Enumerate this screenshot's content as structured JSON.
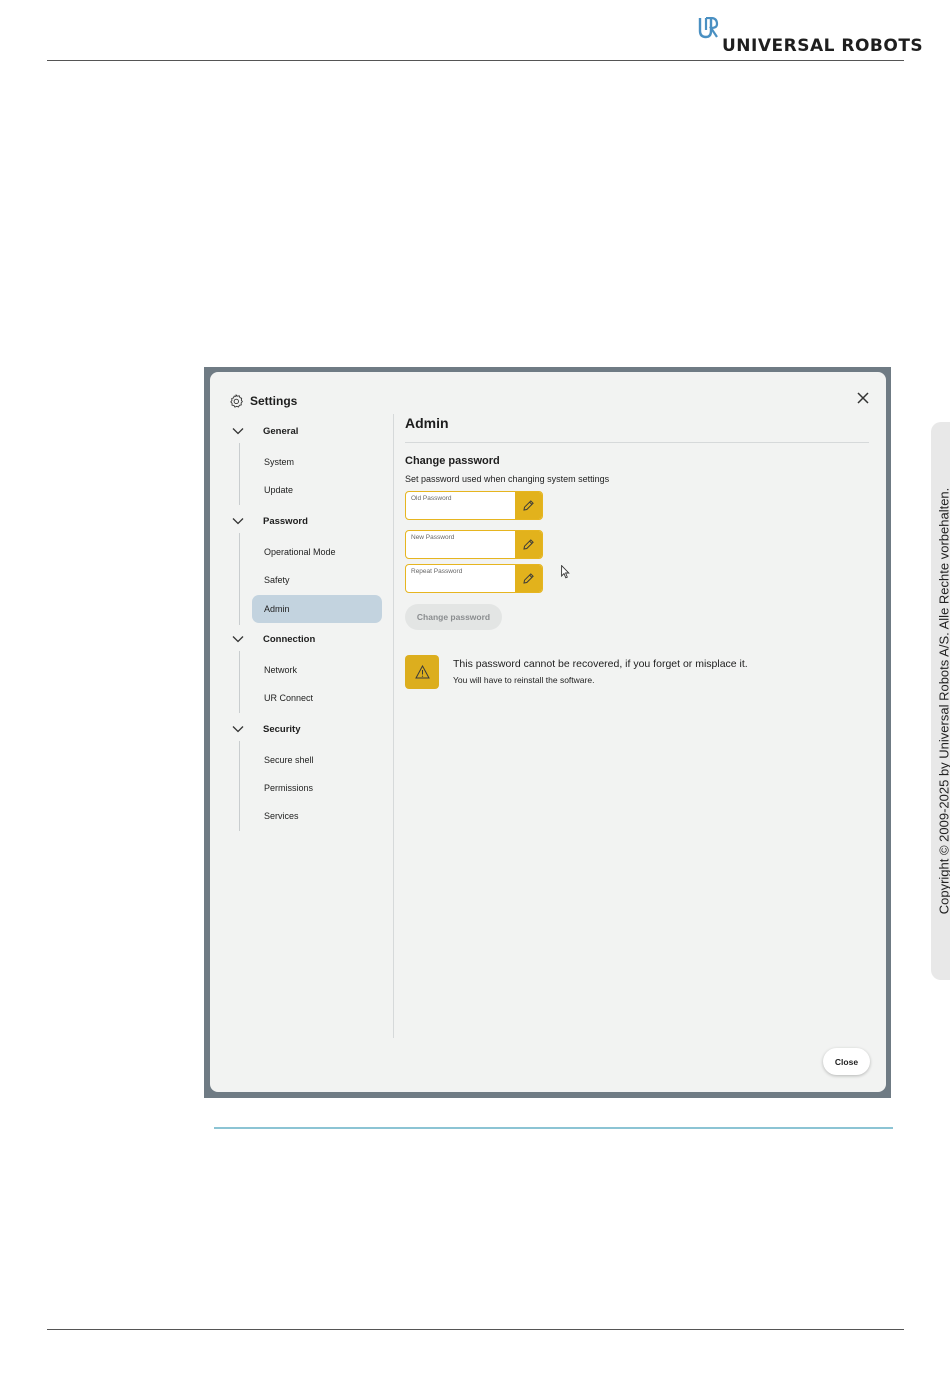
{
  "header": {
    "brand": "UNIVERSAL ROBOTS"
  },
  "copyright": "Copyright © 2009-2025 by Universal Robots A/S. Alle Rechte vorbehalten.",
  "dialog": {
    "title": "Settings",
    "close_icon": "close-icon",
    "nav": [
      {
        "label": "General",
        "items": [
          "System",
          "Update"
        ]
      },
      {
        "label": "Password",
        "items": [
          "Operational Mode",
          "Safety",
          "Admin"
        ]
      },
      {
        "label": "Connection",
        "items": [
          "Network",
          "UR Connect"
        ]
      },
      {
        "label": "Security",
        "items": [
          "Secure shell",
          "Permissions",
          "Services"
        ]
      }
    ],
    "active_item": "Admin",
    "page_title": "Admin",
    "section_title": "Change password",
    "section_desc": "Set password used when changing system settings",
    "fields": {
      "old": {
        "placeholder": "Old Password",
        "value": ""
      },
      "new": {
        "placeholder": "New Password",
        "value": ""
      },
      "repeat": {
        "placeholder": "Repeat Password",
        "value": ""
      }
    },
    "change_button": "Change password",
    "change_button_enabled": false,
    "warning": {
      "icon": "warning-icon",
      "text": "This password cannot be recovered, if you forget or misplace it.",
      "subtext": "You will have to reinstall the software."
    },
    "close_button": "Close"
  },
  "colors": {
    "accent_yellow": "#e2b21c",
    "active_nav": "#c3d3df",
    "frame": "#6f7b84",
    "logo_blue": "#4a90c2",
    "divider_blue": "#8cc4d4"
  }
}
